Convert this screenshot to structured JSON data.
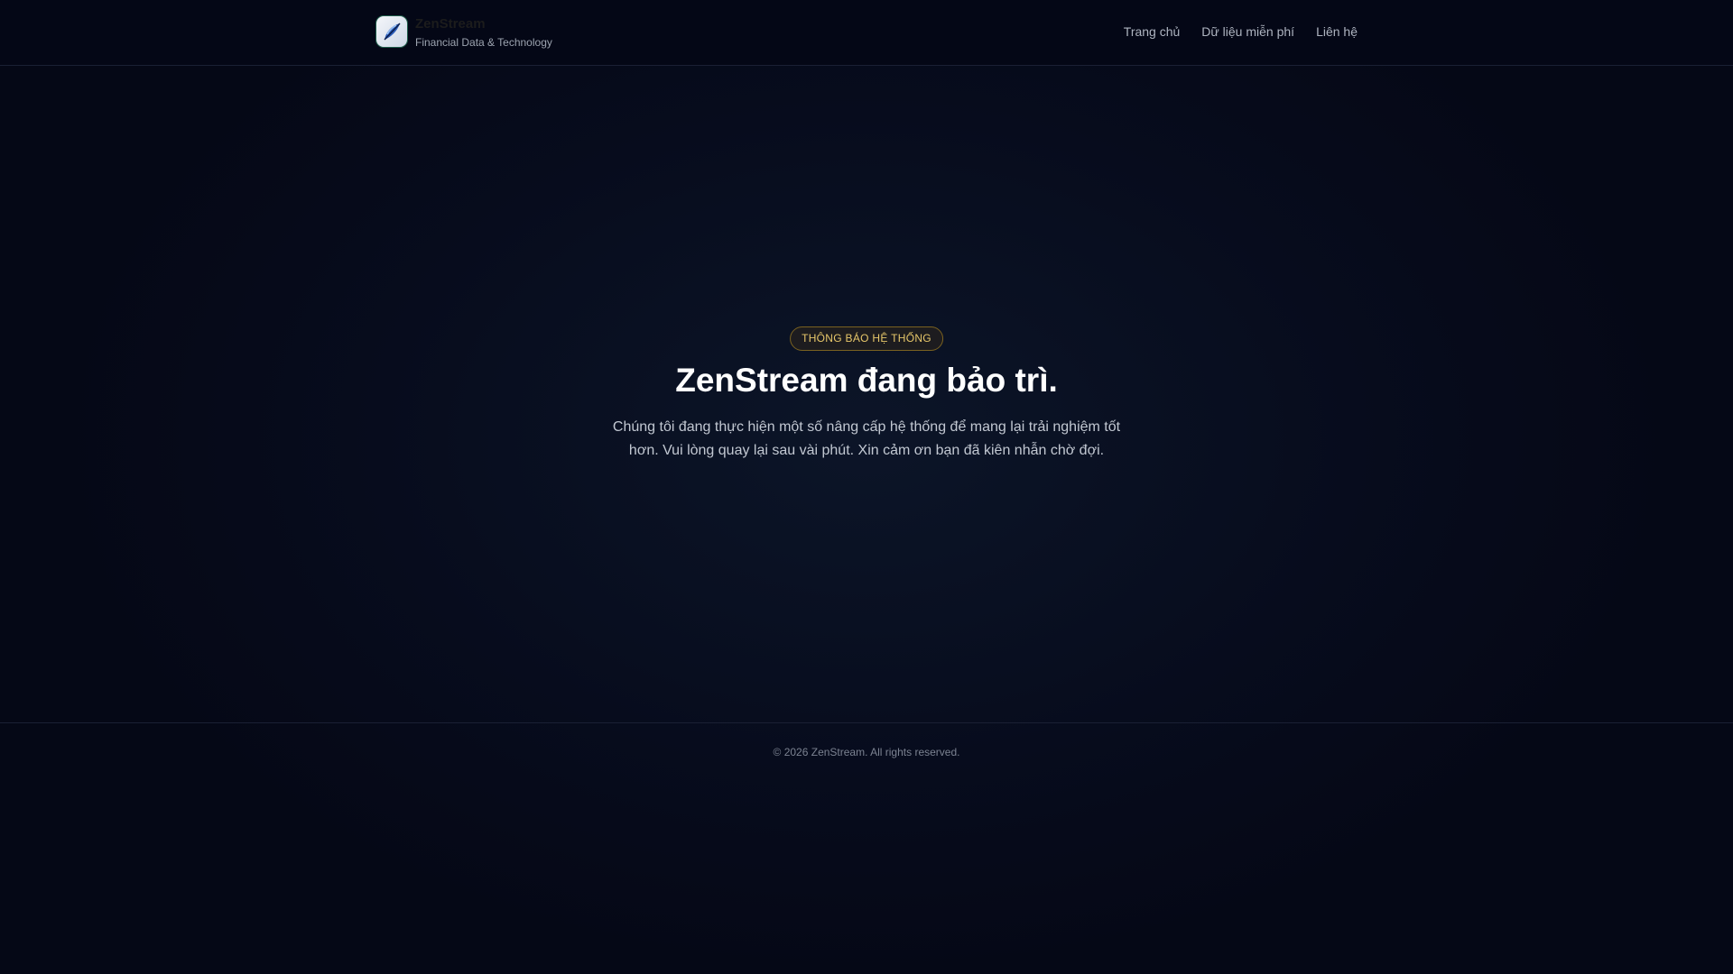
{
  "header": {
    "brand": "ZenStream",
    "tagline": "Financial Data & Technology",
    "nav": [
      "Trang chủ",
      "Dữ liệu miễn phí",
      "Liên hệ"
    ]
  },
  "main": {
    "badge": "THÔNG BÁO HỆ THỐNG",
    "title": "ZenStream đang bảo trì.",
    "message": "Chúng tôi đang thực hiện một số nâng cấp hệ thống để mang lại trải nghiệm tốt hơn. Vui lòng quay lại sau vài phút. Xin cảm ơn bạn đã kiên nhẫn chờ đợi."
  },
  "footer": {
    "copyright": "© 2026 ZenStream. All rights reserved."
  }
}
